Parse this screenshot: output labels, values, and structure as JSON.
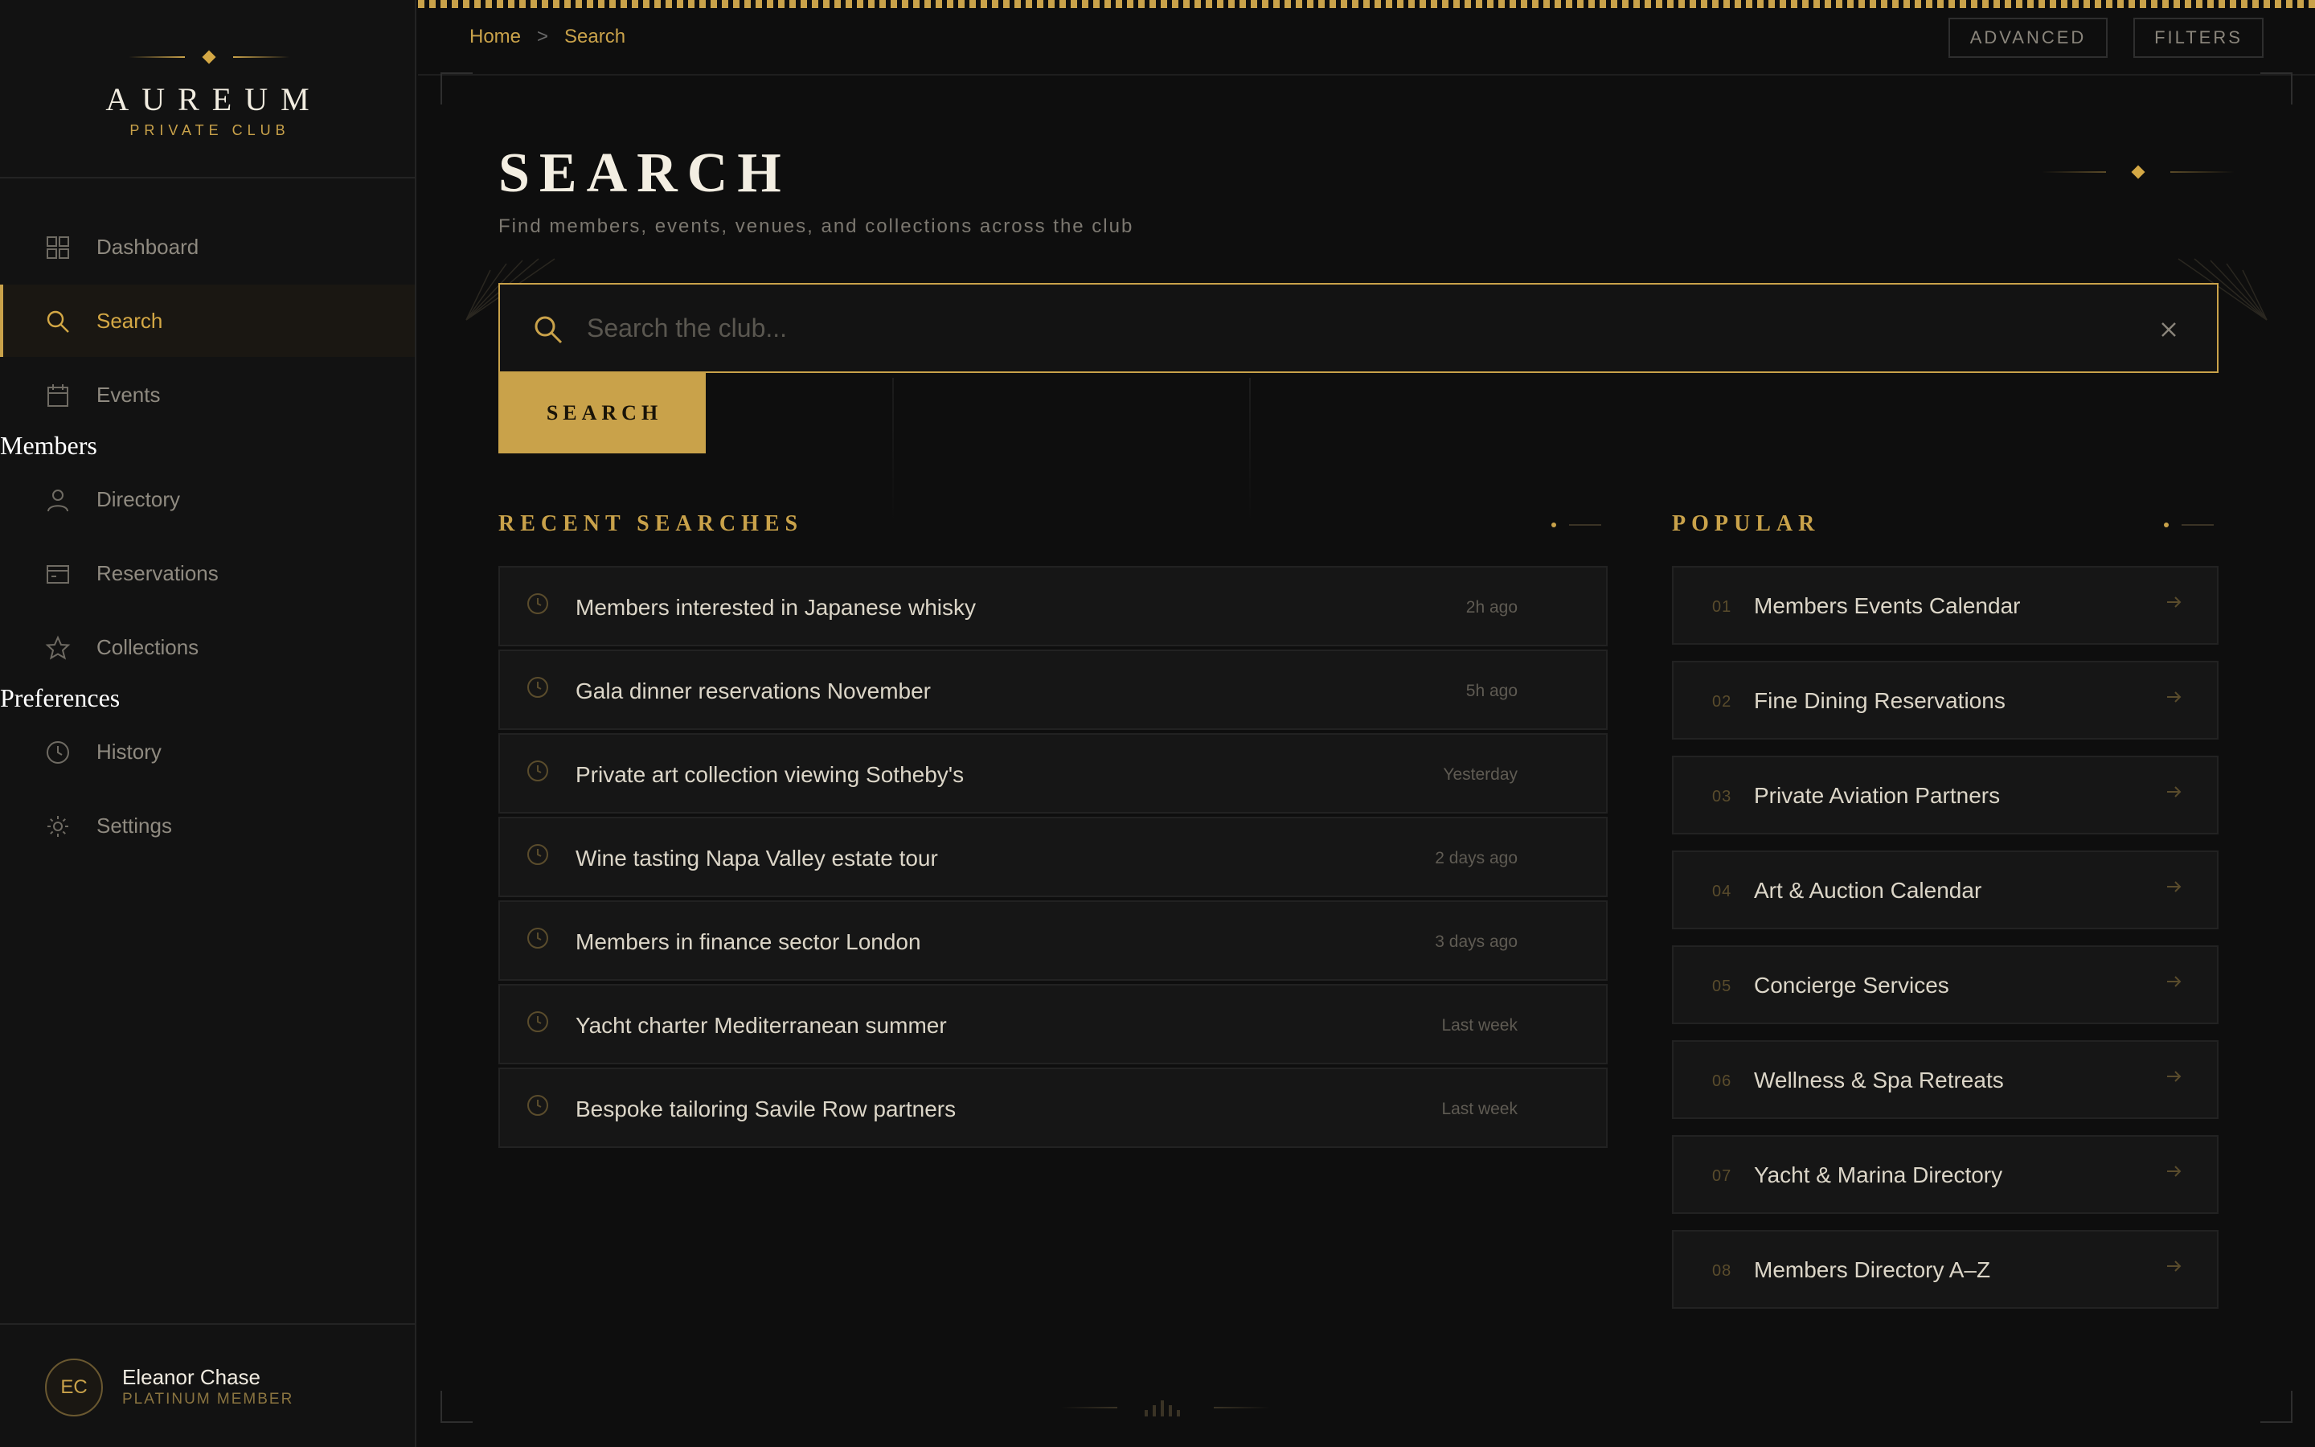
{
  "brand": {
    "name": "AUREUM",
    "tagline": "PRIVATE CLUB"
  },
  "sidebar": {
    "items": [
      {
        "label": "Dashboard",
        "icon": "grid-icon"
      },
      {
        "label": "Search",
        "icon": "search-icon",
        "active": true
      },
      {
        "label": "Events",
        "icon": "calendar-icon"
      }
    ],
    "members_section": "Members",
    "members_items": [
      {
        "label": "Directory",
        "icon": "person-icon"
      },
      {
        "label": "Reservations",
        "icon": "card-icon"
      },
      {
        "label": "Collections",
        "icon": "star-icon"
      }
    ],
    "preferences_section": "Preferences",
    "preferences_items": [
      {
        "label": "History",
        "icon": "clock-icon"
      },
      {
        "label": "Settings",
        "icon": "sun-gear-icon"
      }
    ]
  },
  "user": {
    "initials": "EC",
    "name": "Eleanor Chase",
    "tier": "PLATINUM MEMBER"
  },
  "breadcrumb": {
    "home": "Home",
    "separator": ">",
    "current": "Search"
  },
  "toolbar": {
    "advanced": "ADVANCED",
    "filters": "FILTERS"
  },
  "page": {
    "title": "SEARCH",
    "subtitle": "Find members, events, venues, and collections across the club"
  },
  "search": {
    "placeholder": "Search the club...",
    "value": "",
    "button": "SEARCH"
  },
  "recent": {
    "title": "RECENT SEARCHES",
    "items": [
      {
        "text": "Members interested in Japanese whisky",
        "time": "2h ago"
      },
      {
        "text": "Gala dinner reservations November",
        "time": "5h ago"
      },
      {
        "text": "Private art collection viewing Sotheby's",
        "time": "Yesterday"
      },
      {
        "text": "Wine tasting Napa Valley estate tour",
        "time": "2 days ago"
      },
      {
        "text": "Members in finance sector London",
        "time": "3 days ago"
      },
      {
        "text": "Yacht charter Mediterranean summer",
        "time": "Last week"
      },
      {
        "text": "Bespoke tailoring Savile Row partners",
        "time": "Last week"
      }
    ]
  },
  "popular": {
    "title": "POPULAR",
    "items": [
      {
        "num": "01",
        "text": "Members Events Calendar"
      },
      {
        "num": "02",
        "text": "Fine Dining Reservations"
      },
      {
        "num": "03",
        "text": "Private Aviation Partners"
      },
      {
        "num": "04",
        "text": "Art & Auction Calendar"
      },
      {
        "num": "05",
        "text": "Concierge Services"
      },
      {
        "num": "06",
        "text": "Wellness & Spa Retreats"
      },
      {
        "num": "07",
        "text": "Yacht & Marina Directory"
      },
      {
        "num": "08",
        "text": "Members Directory A–Z"
      }
    ]
  },
  "colors": {
    "accent": "#c9a24a",
    "background": "#0e0e0e",
    "sidebar": "#121212",
    "row": "#161616"
  }
}
